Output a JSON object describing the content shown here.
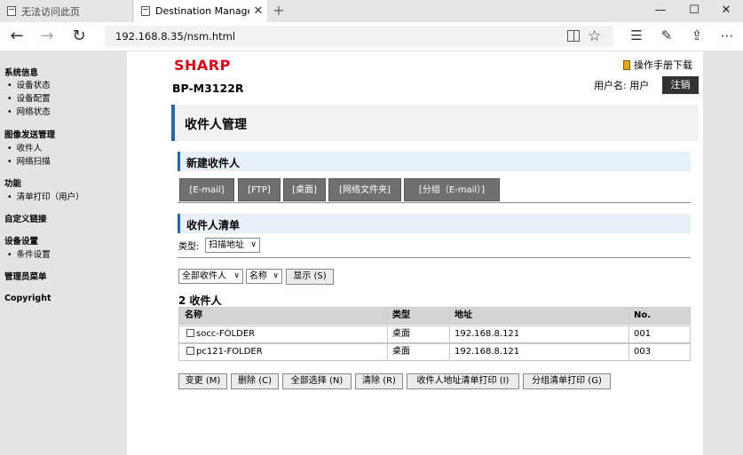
{
  "browser": {
    "tabs": [
      {
        "title": "无法访问此页"
      },
      {
        "title": "Destination Managemer"
      }
    ],
    "newtab_glyph": "+",
    "close_glyph": "✕",
    "window_controls": {
      "minimize": "—",
      "maximize": "☐",
      "close": "✕"
    },
    "url": "192.168.8.35/nsm.html"
  },
  "leftnav": {
    "sections": [
      {
        "title": "系统信息",
        "items": [
          "设备状态",
          "设备配置",
          "网络状态"
        ]
      },
      {
        "title": "图像发送管理",
        "items": [
          "收件人",
          "网络扫描"
        ]
      },
      {
        "title": "功能",
        "items": [
          "清单打印（用户）"
        ]
      },
      {
        "title": "自定义链接",
        "items": []
      },
      {
        "title": "设备设置",
        "items": [
          "条件设置"
        ]
      },
      {
        "title": "管理员菜单",
        "items": []
      },
      {
        "title": "Copyright",
        "items": []
      }
    ]
  },
  "header": {
    "logo": "SHARP",
    "logo_color": "#e60012",
    "model": "BP-M3122R",
    "manual_link": "操作手册下载",
    "user_label": "用户名:",
    "user_name": "用户",
    "logout_label": "注销"
  },
  "page": {
    "title": "收件人管理",
    "accent_color": "#1c6ab8",
    "new_section": {
      "title": "新建收件人",
      "tabs": [
        "[E-mail]",
        "[FTP]",
        "[桌面]",
        "[网络文件夹]",
        "[分组（E-mail）]"
      ]
    },
    "list_section": {
      "title": "收件人清单",
      "type_label": "类型:",
      "type_value": "扫描地址",
      "filter_value": "全部收件人",
      "sort_value": "名称",
      "show_button": "显示 (S)",
      "count_text": "2 收件人",
      "columns": [
        "名称",
        "类型",
        "地址",
        "No."
      ],
      "rows": [
        {
          "name": "socc-FOLDER",
          "type": "桌面",
          "address": "192.168.8.121",
          "no": "001"
        },
        {
          "name": "pc121-FOLDER",
          "type": "桌面",
          "address": "192.168.8.121",
          "no": "003"
        }
      ]
    },
    "actions": [
      "变更 (M)",
      "删除 (C)",
      "全部选择 (N)",
      "清除 (R)",
      "收件人地址清单打印 (I)",
      "分组清单打印 (G)"
    ]
  }
}
